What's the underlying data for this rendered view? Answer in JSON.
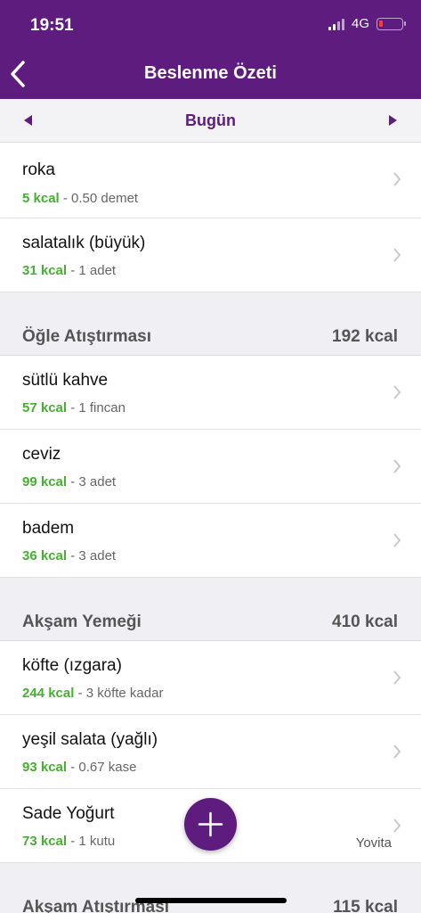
{
  "status": {
    "time": "19:51",
    "network": "4G"
  },
  "nav": {
    "title": "Beslenme Özeti",
    "date": "Bugün"
  },
  "brand_color": "#5e1c7f",
  "kcal_color": "#44b02f",
  "icons": [
    "back-chevron-icon",
    "triangle-left-icon",
    "triangle-right-icon",
    "chevron-right-icon",
    "plus-icon",
    "signal-icon",
    "battery-icon"
  ],
  "first_items": [
    {
      "name": "roka",
      "kcal": "5 kcal",
      "qty": " - 0.50 demet"
    },
    {
      "name": "salatalık (büyük)",
      "kcal": "31 kcal",
      "qty": " - 1 adet"
    }
  ],
  "sections": [
    {
      "name": "Öğle Atıştırması",
      "kcal": "192 kcal",
      "items": [
        {
          "name": "sütlü kahve",
          "kcal": "57 kcal",
          "qty": " - 1 fincan"
        },
        {
          "name": "ceviz",
          "kcal": "99 kcal",
          "qty": " - 3 adet"
        },
        {
          "name": "badem",
          "kcal": "36 kcal",
          "qty": " - 3 adet"
        }
      ]
    },
    {
      "name": "Akşam Yemeği",
      "kcal": "410 kcal",
      "items": [
        {
          "name": "köfte (ızgara)",
          "kcal": "244 kcal",
          "qty": " - 3 köfte kadar"
        },
        {
          "name": "yeşil salata (yağlı)",
          "kcal": "93 kcal",
          "qty": " - 0.67 kase"
        },
        {
          "name": "Sade Yoğurt",
          "kcal": "73 kcal",
          "qty": " - 1 kutu",
          "brand": "Yovita"
        }
      ]
    },
    {
      "name": "Akşam Atıştırması",
      "kcal": "115 kcal",
      "items": []
    }
  ]
}
